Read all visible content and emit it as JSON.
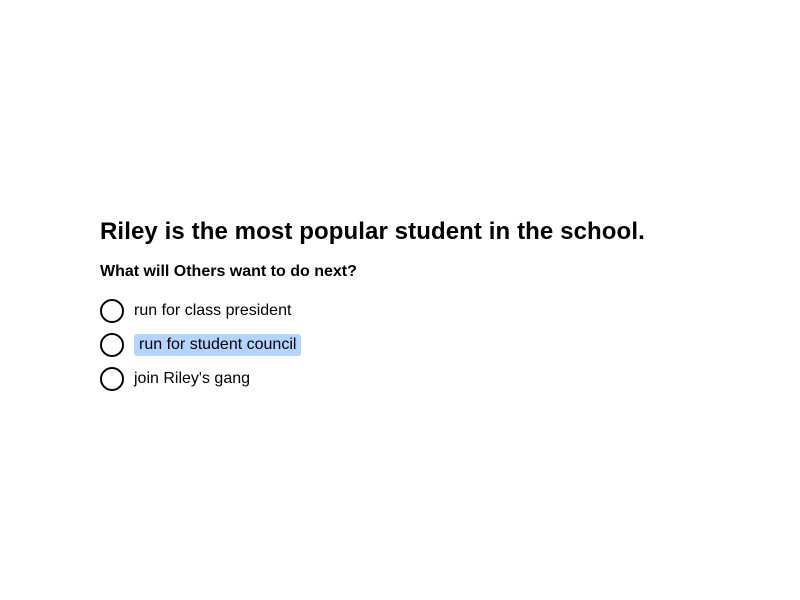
{
  "question": {
    "title": "Riley is the most popular student in the school.",
    "prompt": "What will Others want to do next?"
  },
  "options": [
    {
      "label": "run for class president",
      "highlighted": false
    },
    {
      "label": "run for student council",
      "highlighted": true
    },
    {
      "label": "join Riley's gang",
      "highlighted": false
    }
  ],
  "colors": {
    "highlight": "#b3d4ff",
    "text": "#000000",
    "background": "#ffffff"
  }
}
